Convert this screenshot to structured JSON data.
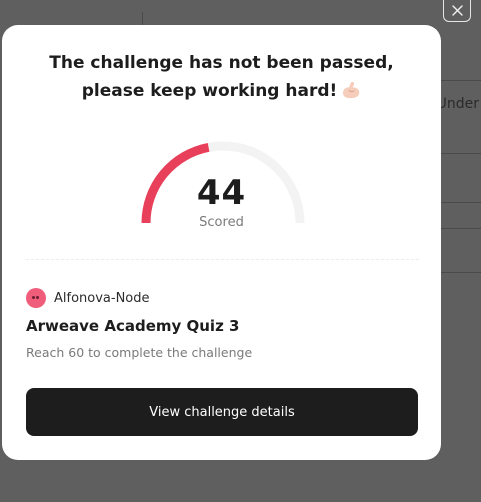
{
  "background": {
    "partial_text": "Under"
  },
  "close_button": {
    "icon": "close-icon"
  },
  "modal": {
    "title_line1": "The challenge has not been passed,",
    "title_line2": "please keep working hard!",
    "title_emoji": "flexed-biceps-icon",
    "score": "44",
    "score_label": "Scored",
    "score_fraction": 0.44,
    "gauge_color": "#e8405a",
    "gauge_track_color": "#f3f3f3",
    "author_name": "Alfonova-Node",
    "avatar_color": "#ef5d7b",
    "quiz_title": "Arweave Academy Quiz 3",
    "requirement_text": "Reach 60 to complete the challenge",
    "cta_label": "View challenge details"
  }
}
